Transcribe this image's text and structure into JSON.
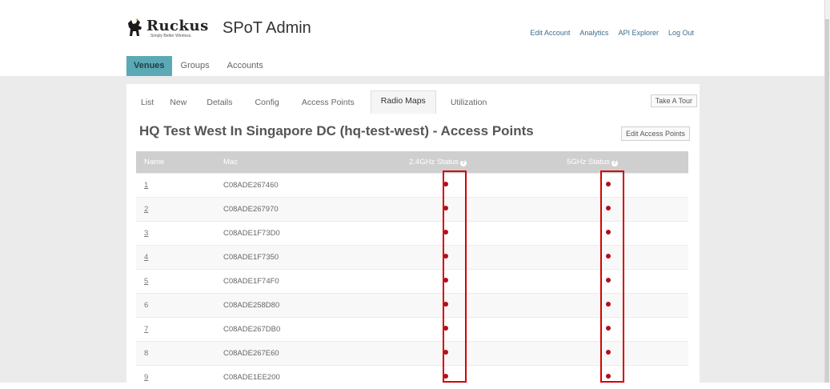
{
  "brand": {
    "logo_word": "Ruckus",
    "logo_tagline": "Simply Better Wireless.",
    "app_title": "SPoT Admin"
  },
  "top_links": [
    "Edit Account",
    "Analytics",
    "API Explorer",
    "Log Out"
  ],
  "main_tabs": [
    {
      "label": "Venues",
      "active": true
    },
    {
      "label": "Groups",
      "active": false
    },
    {
      "label": "Accounts",
      "active": false
    }
  ],
  "sub_tabs": [
    {
      "label": "List",
      "active": false
    },
    {
      "label": "New",
      "active": false
    },
    {
      "label": "Details",
      "active": false
    },
    {
      "label": "Config",
      "active": false
    },
    {
      "label": "Access Points",
      "active": false
    },
    {
      "label": "Radio Maps",
      "active": true
    },
    {
      "label": "Utilization",
      "active": false
    }
  ],
  "take_tour_label": "Take A Tour",
  "page_heading": "HQ Test West In Singapore DC (hq-test-west) - Access Points",
  "edit_access_points_label": "Edit Access Points",
  "table": {
    "columns": [
      "Name",
      "Mac",
      "2.4GHz Status",
      "5GHz Status"
    ],
    "rows": [
      {
        "name": "1",
        "mac": "C08ADE267460",
        "linked": true
      },
      {
        "name": "2",
        "mac": "C08ADE267970",
        "linked": true
      },
      {
        "name": "3",
        "mac": "C08ADE1F73D0",
        "linked": true
      },
      {
        "name": "4",
        "mac": "C08ADE1F7350",
        "linked": true
      },
      {
        "name": "5",
        "mac": "C08ADE1F74F0",
        "linked": true
      },
      {
        "name": "6",
        "mac": "C08ADE258D80",
        "linked": false
      },
      {
        "name": "7",
        "mac": "C08ADE267DB0",
        "linked": true
      },
      {
        "name": "8",
        "mac": "C08ADE267E60",
        "linked": false
      },
      {
        "name": "9",
        "mac": "C08ADE1EE200",
        "linked": true
      }
    ],
    "status_color": "#b10f1f"
  },
  "colors": {
    "active_tab": "#5ba9b5",
    "highlight": "#d60000"
  }
}
